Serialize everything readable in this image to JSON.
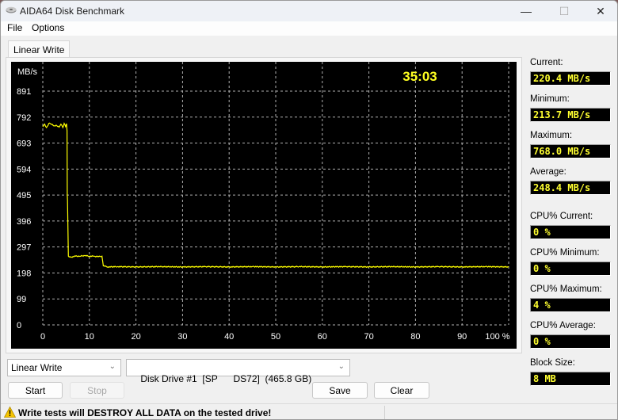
{
  "window": {
    "title": "AIDA64 Disk Benchmark",
    "controls": {
      "minimize": "—",
      "maximize": "☐",
      "close": "✕"
    }
  },
  "menu": [
    "File",
    "Options"
  ],
  "tabs": [
    {
      "label": "Linear Write",
      "active": true
    }
  ],
  "chart": {
    "elapsed": "35:03",
    "y_unit": "MB/s"
  },
  "chart_data": {
    "type": "line",
    "title": "",
    "xlabel": "%",
    "ylabel": "MB/s",
    "xlim": [
      0,
      100
    ],
    "ylim": [
      0,
      891
    ],
    "x_ticks": [
      "0",
      "10",
      "20",
      "30",
      "40",
      "50",
      "60",
      "70",
      "80",
      "90",
      "100 %"
    ],
    "y_ticks": [
      "0",
      "99",
      "198",
      "297",
      "396",
      "495",
      "594",
      "693",
      "792",
      "891"
    ],
    "grid": true,
    "series": [
      {
        "name": "Linear Write",
        "color": "#ffff00",
        "points": [
          [
            0,
            755
          ],
          [
            0.4,
            765
          ],
          [
            0.8,
            752
          ],
          [
            1.3,
            768
          ],
          [
            1.8,
            766
          ],
          [
            2.4,
            758
          ],
          [
            3.0,
            760
          ],
          [
            3.5,
            754
          ],
          [
            3.9,
            765
          ],
          [
            4.3,
            752
          ],
          [
            4.6,
            768
          ],
          [
            4.9,
            756
          ],
          [
            5.1,
            767
          ],
          [
            5.2,
            740
          ],
          [
            5.25,
            495
          ],
          [
            5.3,
            475
          ],
          [
            5.5,
            262
          ],
          [
            6.0,
            258
          ],
          [
            7.0,
            262
          ],
          [
            8.0,
            262
          ],
          [
            9.0,
            264
          ],
          [
            10.0,
            262
          ],
          [
            11.0,
            262
          ],
          [
            12.0,
            260
          ],
          [
            12.7,
            262
          ],
          [
            13.0,
            225
          ],
          [
            14.0,
            221
          ],
          [
            16.0,
            222
          ],
          [
            20.0,
            221
          ],
          [
            25.0,
            222
          ],
          [
            30.0,
            221
          ],
          [
            35.0,
            222
          ],
          [
            40.0,
            221
          ],
          [
            45.0,
            222
          ],
          [
            50.0,
            221
          ],
          [
            55.0,
            222
          ],
          [
            60.0,
            221
          ],
          [
            65.0,
            222
          ],
          [
            70.0,
            221
          ],
          [
            75.0,
            222
          ],
          [
            80.0,
            221
          ],
          [
            85.0,
            222
          ],
          [
            90.0,
            221
          ],
          [
            95.0,
            222
          ],
          [
            100.0,
            221
          ]
        ]
      }
    ]
  },
  "stats": [
    {
      "label": "Current:",
      "value": "220.4 MB/s"
    },
    {
      "label": "Minimum:",
      "value": "213.7 MB/s"
    },
    {
      "label": "Maximum:",
      "value": "768.0 MB/s"
    },
    {
      "label": "Average:",
      "value": "248.4 MB/s"
    },
    {
      "label": "CPU% Current:",
      "value": "0 %"
    },
    {
      "label": "CPU% Minimum:",
      "value": "0 %"
    },
    {
      "label": "CPU% Maximum:",
      "value": "4 %"
    },
    {
      "label": "CPU% Average:",
      "value": "0 %"
    },
    {
      "label": "Block Size:",
      "value": "8 MB"
    }
  ],
  "controls": {
    "test_select": "Linear Write",
    "drive_select": "Disk Drive #1  [SP      DS72]  (465.8 GB)",
    "start": "Start",
    "stop": "Stop",
    "save": "Save",
    "clear": "Clear"
  },
  "status": {
    "warning": "Write tests will DESTROY ALL DATA on the tested drive!"
  },
  "colors": {
    "plot_bg": "#000000",
    "trace": "#ffff00",
    "grid": "#b0b0b0",
    "value_text": "#ffff30"
  }
}
